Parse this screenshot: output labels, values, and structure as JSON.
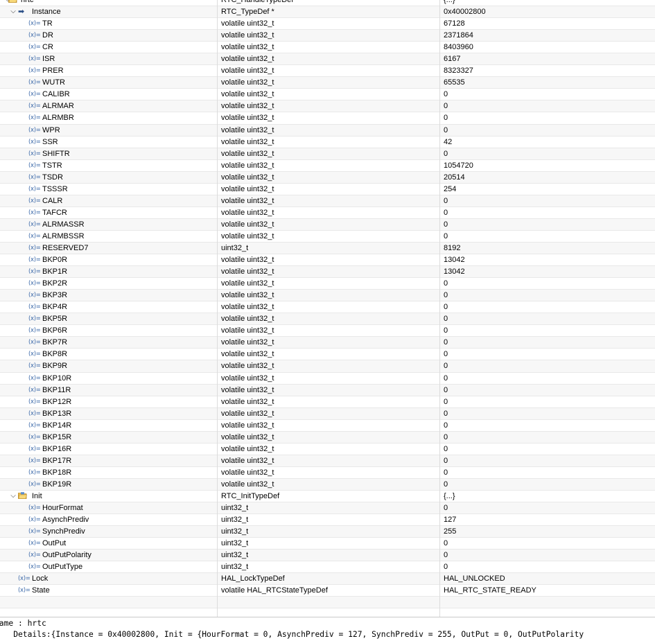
{
  "rows": [
    {
      "name": "hrtc",
      "type": "RTC_HandleTypeDef",
      "value": "{...}",
      "depth": 0,
      "kind": "struct",
      "expand": "open"
    },
    {
      "name": "Instance",
      "type": "RTC_TypeDef *",
      "value": "0x40002800",
      "depth": 1,
      "kind": "pointer",
      "expand": "open"
    },
    {
      "name": "TR",
      "type": "volatile uint32_t",
      "value": "67128",
      "depth": 2,
      "kind": "var"
    },
    {
      "name": "DR",
      "type": "volatile uint32_t",
      "value": "2371864",
      "depth": 2,
      "kind": "var"
    },
    {
      "name": "CR",
      "type": "volatile uint32_t",
      "value": "8403960",
      "depth": 2,
      "kind": "var"
    },
    {
      "name": "ISR",
      "type": "volatile uint32_t",
      "value": "6167",
      "depth": 2,
      "kind": "var"
    },
    {
      "name": "PRER",
      "type": "volatile uint32_t",
      "value": "8323327",
      "depth": 2,
      "kind": "var"
    },
    {
      "name": "WUTR",
      "type": "volatile uint32_t",
      "value": "65535",
      "depth": 2,
      "kind": "var"
    },
    {
      "name": "CALIBR",
      "type": "volatile uint32_t",
      "value": "0",
      "depth": 2,
      "kind": "var"
    },
    {
      "name": "ALRMAR",
      "type": "volatile uint32_t",
      "value": "0",
      "depth": 2,
      "kind": "var"
    },
    {
      "name": "ALRMBR",
      "type": "volatile uint32_t",
      "value": "0",
      "depth": 2,
      "kind": "var"
    },
    {
      "name": "WPR",
      "type": "volatile uint32_t",
      "value": "0",
      "depth": 2,
      "kind": "var"
    },
    {
      "name": "SSR",
      "type": "volatile uint32_t",
      "value": "42",
      "depth": 2,
      "kind": "var"
    },
    {
      "name": "SHIFTR",
      "type": "volatile uint32_t",
      "value": "0",
      "depth": 2,
      "kind": "var"
    },
    {
      "name": "TSTR",
      "type": "volatile uint32_t",
      "value": "1054720",
      "depth": 2,
      "kind": "var"
    },
    {
      "name": "TSDR",
      "type": "volatile uint32_t",
      "value": "20514",
      "depth": 2,
      "kind": "var"
    },
    {
      "name": "TSSSR",
      "type": "volatile uint32_t",
      "value": "254",
      "depth": 2,
      "kind": "var"
    },
    {
      "name": "CALR",
      "type": "volatile uint32_t",
      "value": "0",
      "depth": 2,
      "kind": "var"
    },
    {
      "name": "TAFCR",
      "type": "volatile uint32_t",
      "value": "0",
      "depth": 2,
      "kind": "var"
    },
    {
      "name": "ALRMASSR",
      "type": "volatile uint32_t",
      "value": "0",
      "depth": 2,
      "kind": "var"
    },
    {
      "name": "ALRMBSSR",
      "type": "volatile uint32_t",
      "value": "0",
      "depth": 2,
      "kind": "var"
    },
    {
      "name": "RESERVED7",
      "type": "uint32_t",
      "value": "8192",
      "depth": 2,
      "kind": "var"
    },
    {
      "name": "BKP0R",
      "type": "volatile uint32_t",
      "value": "13042",
      "depth": 2,
      "kind": "var"
    },
    {
      "name": "BKP1R",
      "type": "volatile uint32_t",
      "value": "13042",
      "depth": 2,
      "kind": "var"
    },
    {
      "name": "BKP2R",
      "type": "volatile uint32_t",
      "value": "0",
      "depth": 2,
      "kind": "var"
    },
    {
      "name": "BKP3R",
      "type": "volatile uint32_t",
      "value": "0",
      "depth": 2,
      "kind": "var"
    },
    {
      "name": "BKP4R",
      "type": "volatile uint32_t",
      "value": "0",
      "depth": 2,
      "kind": "var"
    },
    {
      "name": "BKP5R",
      "type": "volatile uint32_t",
      "value": "0",
      "depth": 2,
      "kind": "var"
    },
    {
      "name": "BKP6R",
      "type": "volatile uint32_t",
      "value": "0",
      "depth": 2,
      "kind": "var"
    },
    {
      "name": "BKP7R",
      "type": "volatile uint32_t",
      "value": "0",
      "depth": 2,
      "kind": "var"
    },
    {
      "name": "BKP8R",
      "type": "volatile uint32_t",
      "value": "0",
      "depth": 2,
      "kind": "var"
    },
    {
      "name": "BKP9R",
      "type": "volatile uint32_t",
      "value": "0",
      "depth": 2,
      "kind": "var"
    },
    {
      "name": "BKP10R",
      "type": "volatile uint32_t",
      "value": "0",
      "depth": 2,
      "kind": "var"
    },
    {
      "name": "BKP11R",
      "type": "volatile uint32_t",
      "value": "0",
      "depth": 2,
      "kind": "var"
    },
    {
      "name": "BKP12R",
      "type": "volatile uint32_t",
      "value": "0",
      "depth": 2,
      "kind": "var"
    },
    {
      "name": "BKP13R",
      "type": "volatile uint32_t",
      "value": "0",
      "depth": 2,
      "kind": "var"
    },
    {
      "name": "BKP14R",
      "type": "volatile uint32_t",
      "value": "0",
      "depth": 2,
      "kind": "var"
    },
    {
      "name": "BKP15R",
      "type": "volatile uint32_t",
      "value": "0",
      "depth": 2,
      "kind": "var"
    },
    {
      "name": "BKP16R",
      "type": "volatile uint32_t",
      "value": "0",
      "depth": 2,
      "kind": "var"
    },
    {
      "name": "BKP17R",
      "type": "volatile uint32_t",
      "value": "0",
      "depth": 2,
      "kind": "var"
    },
    {
      "name": "BKP18R",
      "type": "volatile uint32_t",
      "value": "0",
      "depth": 2,
      "kind": "var"
    },
    {
      "name": "BKP19R",
      "type": "volatile uint32_t",
      "value": "0",
      "depth": 2,
      "kind": "var"
    },
    {
      "name": "Init",
      "type": "RTC_InitTypeDef",
      "value": "{...}",
      "depth": 1,
      "kind": "struct",
      "expand": "open"
    },
    {
      "name": "HourFormat",
      "type": "uint32_t",
      "value": "0",
      "depth": 2,
      "kind": "var"
    },
    {
      "name": "AsynchPrediv",
      "type": "uint32_t",
      "value": "127",
      "depth": 2,
      "kind": "var"
    },
    {
      "name": "SynchPrediv",
      "type": "uint32_t",
      "value": "255",
      "depth": 2,
      "kind": "var"
    },
    {
      "name": "OutPut",
      "type": "uint32_t",
      "value": "0",
      "depth": 2,
      "kind": "var"
    },
    {
      "name": "OutPutPolarity",
      "type": "uint32_t",
      "value": "0",
      "depth": 2,
      "kind": "var"
    },
    {
      "name": "OutPutType",
      "type": "uint32_t",
      "value": "0",
      "depth": 2,
      "kind": "var"
    },
    {
      "name": "Lock",
      "type": "HAL_LockTypeDef",
      "value": "HAL_UNLOCKED",
      "depth": 1,
      "kind": "var"
    },
    {
      "name": "State",
      "type": "volatile HAL_RTCStateTypeDef",
      "value": "HAL_RTC_STATE_READY",
      "depth": 1,
      "kind": "var"
    },
    {
      "name": "",
      "type": "",
      "value": "",
      "depth": 0,
      "kind": "blank"
    }
  ],
  "icons": {
    "var": "(x)=",
    "pointer": "➡",
    "expand_open": "⌵"
  },
  "colors": {
    "var_icon": "#3a68a8",
    "folder": "#e0a830",
    "pointer": "#2a4e86"
  },
  "details": {
    "line1": "Name : hrtc",
    "line2": "    Details:{Instance = 0x40002800, Init = {HourFormat = 0, AsynchPrediv = 127, SynchPrediv = 255, OutPut = 0, OutPutPolarity"
  }
}
